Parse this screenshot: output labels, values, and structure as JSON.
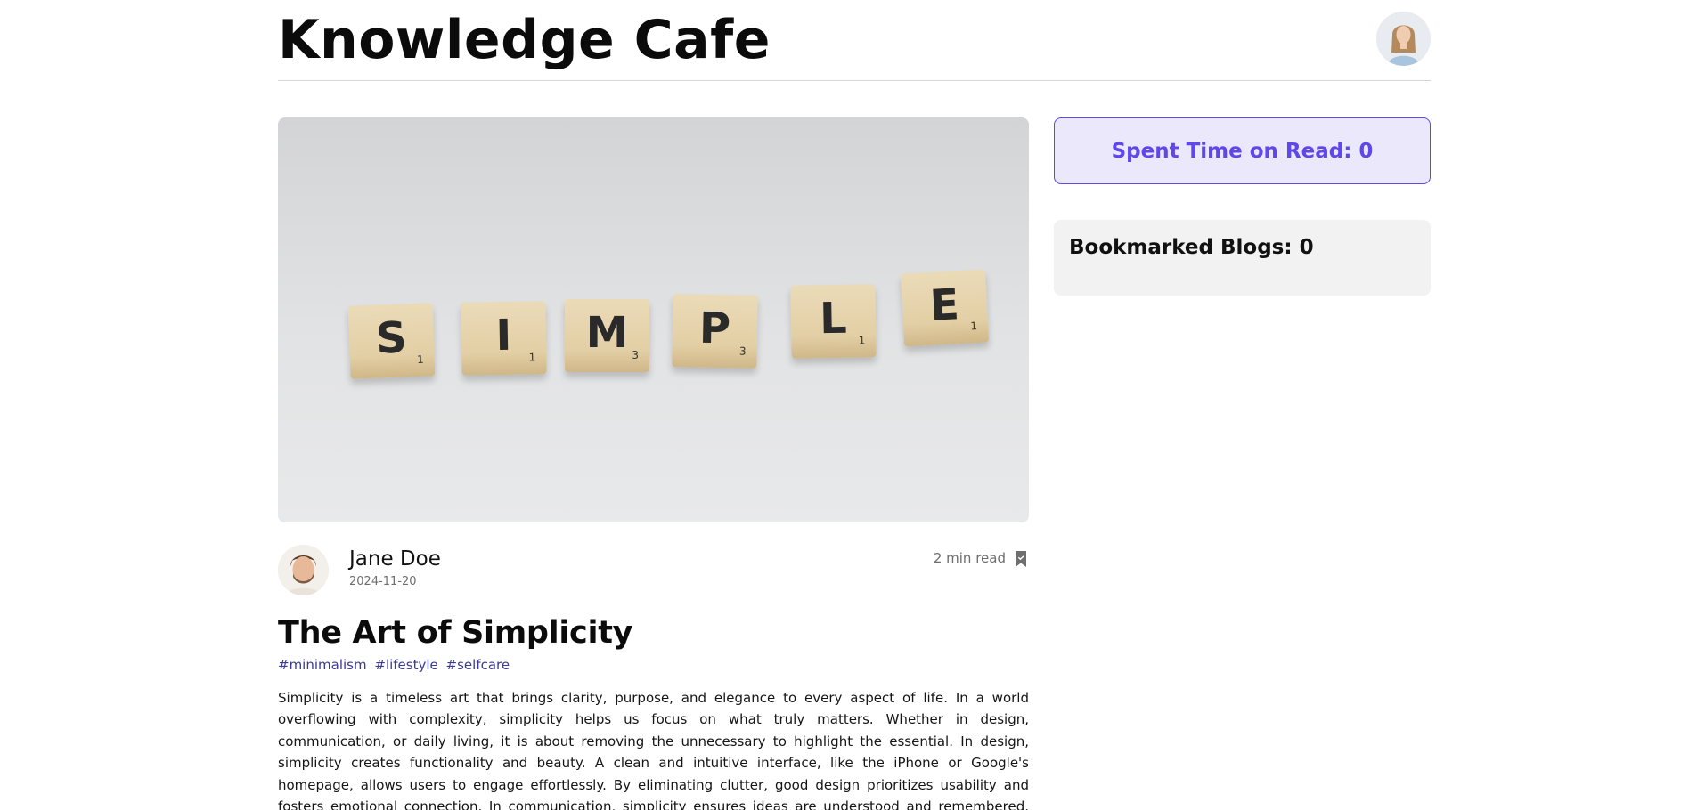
{
  "header": {
    "site_title": "Knowledge Cafe",
    "profile_avatar_icon": "user-avatar-icon"
  },
  "post": {
    "cover_image": {
      "tiles": [
        {
          "letter": "S",
          "points": "1"
        },
        {
          "letter": "I",
          "points": "1"
        },
        {
          "letter": "M",
          "points": "3"
        },
        {
          "letter": "P",
          "points": "3"
        },
        {
          "letter": "L",
          "points": "1"
        },
        {
          "letter": "E",
          "points": "1"
        }
      ]
    },
    "author_name": "Jane Doe",
    "date": "2024-11-20",
    "read_time": "2 min read",
    "bookmark_icon": "bookmark-icon",
    "title": "The Art of Simplicity",
    "tags": [
      "#minimalism",
      "#lifestyle",
      "#selfcare"
    ],
    "body": "Simplicity is a timeless art that brings clarity, purpose, and elegance to every aspect of life. In a world overflowing with complexity, simplicity helps us focus on what truly matters. Whether in design, communication, or daily living, it is about removing the unnecessary to highlight the essential. In design, simplicity creates functionality and beauty. A clean and intuitive interface, like the iPhone or Google's homepage, allows users to engage effortlessly. By eliminating clutter, good design prioritizes usability and fosters emotional connection. In communication, simplicity ensures ideas are understood and remembered. Great leaders and writers distill complex thoughts into"
  },
  "sidebar": {
    "spent_time_label": "Spent Time on Read: 0",
    "bookmarked_label": "Bookmarked Blogs: 0"
  },
  "colors": {
    "accent": "#6047ec",
    "accent_bg": "#ebe8fc",
    "tag": "#3b3b8f",
    "muted": "#6e6e6e",
    "panel_bg": "#f2f2f2"
  }
}
